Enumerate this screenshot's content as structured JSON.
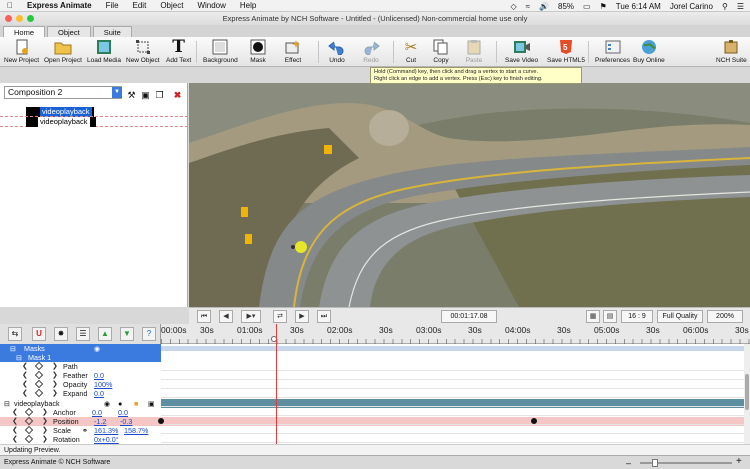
{
  "menubar": {
    "app": "Express Animate",
    "items": [
      "File",
      "Edit",
      "Object",
      "Window",
      "Help"
    ],
    "battery": "85%",
    "clock": "Tue 6:14 AM",
    "user": "Jorel Carino"
  },
  "window": {
    "title": "Express Animate by NCH Software - Untitled - (Unlicensed) Non-commercial home use only"
  },
  "tabs": [
    {
      "label": "Home",
      "active": true
    },
    {
      "label": "Object",
      "active": false
    },
    {
      "label": "Suite",
      "active": false
    }
  ],
  "toolbar": {
    "new_project": "New Project",
    "open_project": "Open Project",
    "load_media": "Load Media",
    "new_object": "New Object",
    "add_text": "Add Text",
    "background": "Background",
    "mask": "Mask",
    "effect": "Effect",
    "undo": "Undo",
    "redo": "Redo",
    "cut": "Cut",
    "copy": "Copy",
    "paste": "Paste",
    "save_video": "Save Video",
    "save_html5": "Save HTML5",
    "preferences": "Preferences",
    "buy_online": "Buy Online",
    "nch_suite": "NCH Suite"
  },
  "tooltip": {
    "line1": "Hold (Command) key, then click and drag a vertex to start a curve.",
    "line2": "Right click an edge to add a vertex. Press (Esc) key to finish editing."
  },
  "composition": {
    "name": "Composition 2",
    "layers": [
      "videoplayback",
      "videoplayback"
    ]
  },
  "player": {
    "timecode": "00:01:17.08",
    "aspect": "16 : 9",
    "quality": "Full Quality",
    "zoom": "200%"
  },
  "ruler": {
    "labels": [
      "00:00s",
      "30s",
      "01:00s",
      "30s",
      "02:00s",
      "30s",
      "03:00s",
      "30s",
      "04:00s",
      "30s",
      "05:00s",
      "30s",
      "06:00s",
      "30s"
    ]
  },
  "timeline": {
    "masks_label": "Masks",
    "mask1_label": "Mask 1",
    "path_label": "Path",
    "feather_label": "Feather",
    "feather_value": "0.0",
    "opacity_label": "Opacity",
    "opacity_value": "100%",
    "expand_label": "Expand",
    "expand_value": "0.0",
    "layer_label": "videoplayback",
    "anchor_label": "Anchor",
    "anchor_x": "0.0",
    "anchor_y": "0.0",
    "position_label": "Position",
    "position_x": "-1.2",
    "position_y": "-0.3",
    "scale_label": "Scale",
    "scale_x": "161.3%",
    "scale_y": "158.7%",
    "rotation_label": "Rotation",
    "rotation_value": "0x+0.0°"
  },
  "status": "Updating Preview.",
  "footer": "Express Animate © NCH Software",
  "colors": {
    "accent": "#3b7be0",
    "playhead": "#e23b3b",
    "selection_row": "#f4c6c6",
    "layer_track": "#5e8fa0"
  }
}
